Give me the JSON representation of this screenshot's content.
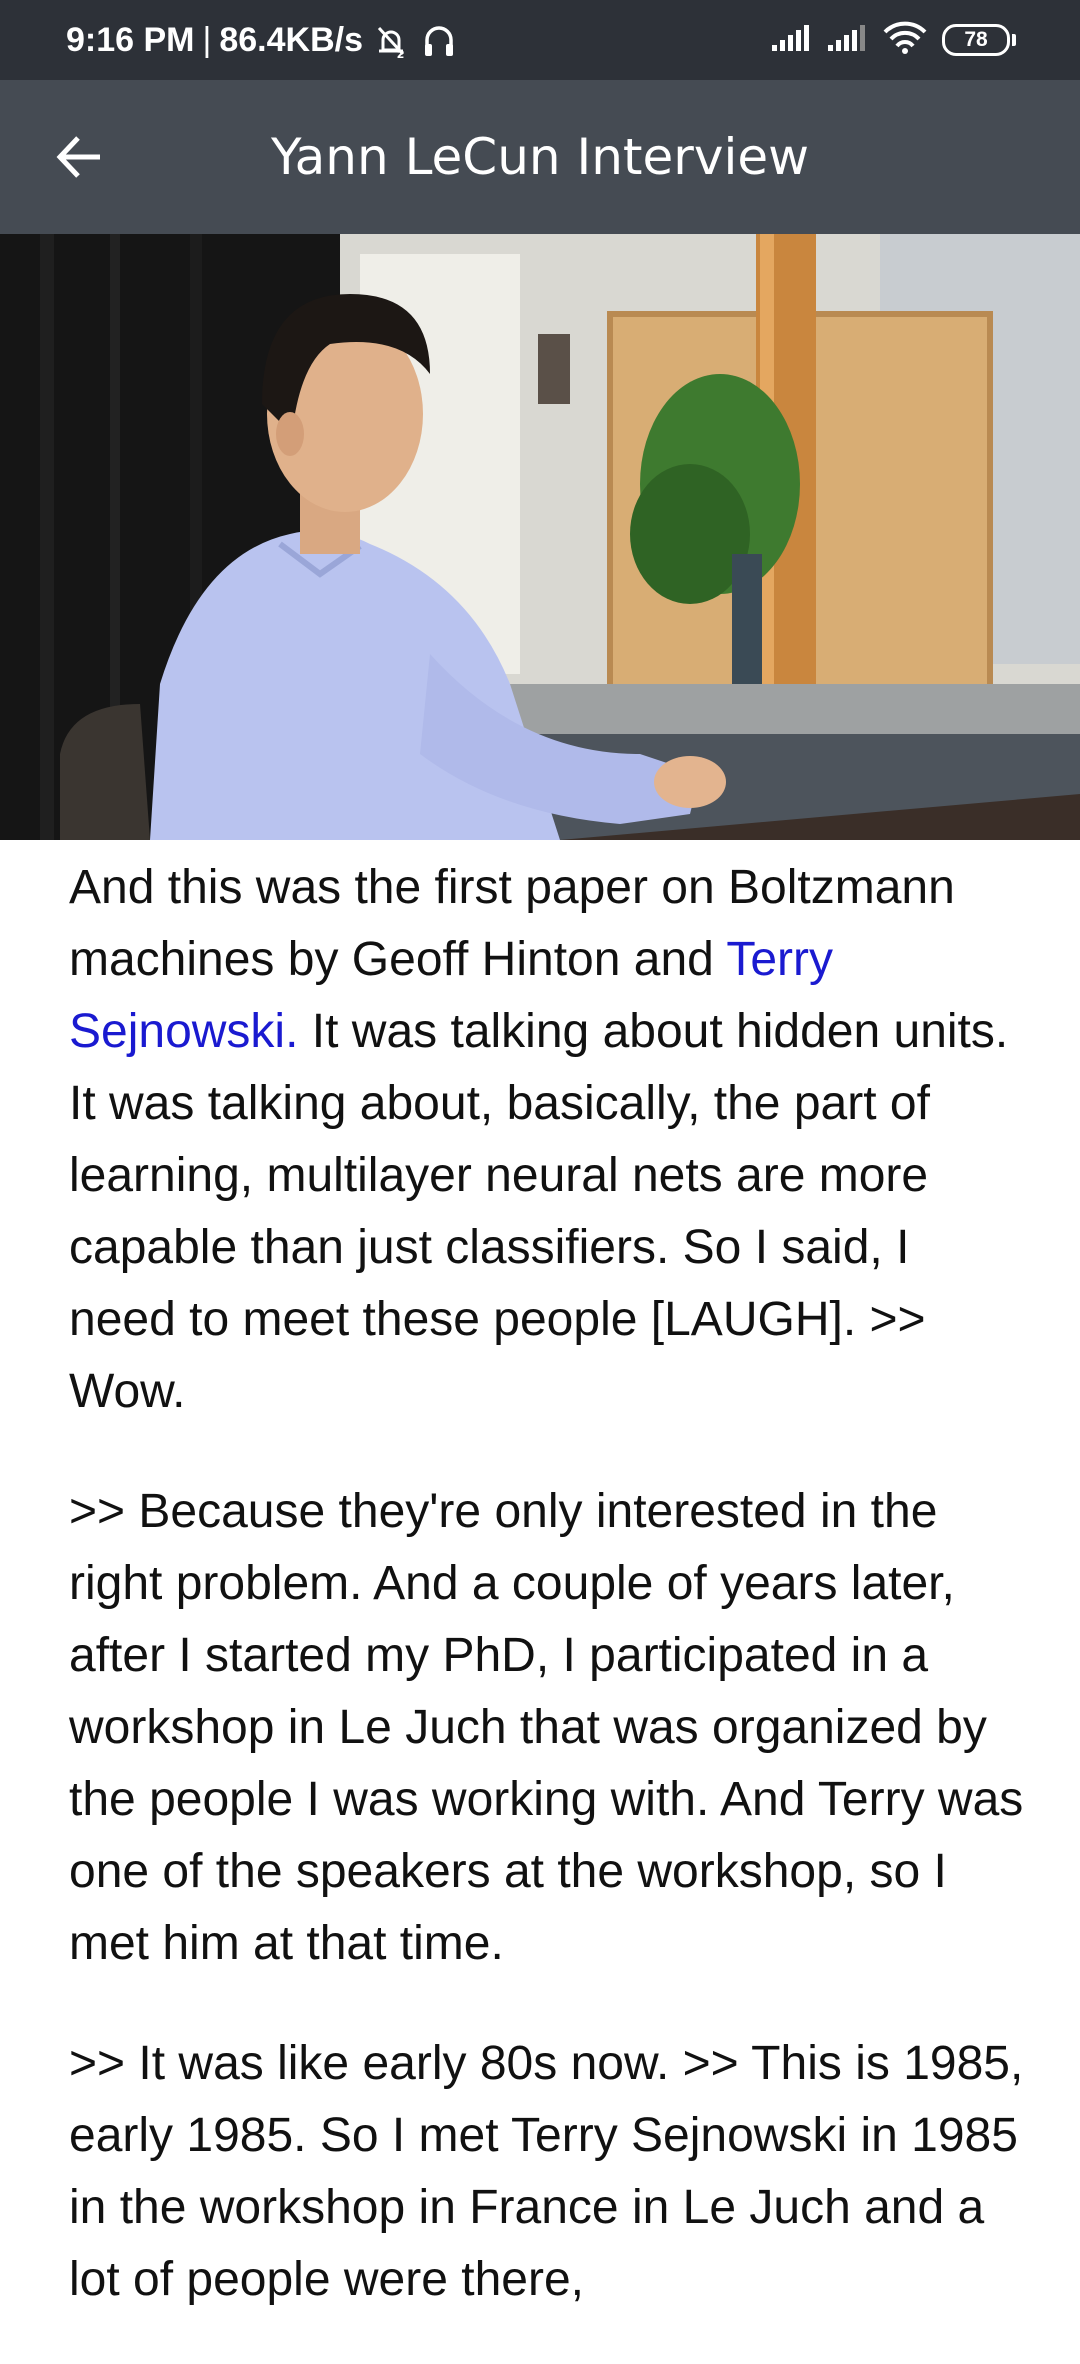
{
  "status_bar": {
    "time": "9:16 PM",
    "separator": "|",
    "speed": "86.4KB/s",
    "icons": [
      "alarm-off-icon",
      "headphones-icon",
      "signal-icon",
      "signal-icon",
      "wifi-icon"
    ],
    "battery": "78"
  },
  "app_bar": {
    "back_icon": "arrow-left-icon",
    "title": "Yann LeCun Interview"
  },
  "transcript": {
    "p1_part1": "And this was the first paper on Boltzmann machines by Geoff Hinton and ",
    "p1_link": "Terry Sejnowski.",
    "p1_part2": " It was talking about hidden units. It was talking about, basically, the part of learning, multilayer neural nets are more capable than just classifiers. So I said, I need to meet these people [LAUGH].  >> Wow.",
    "p2": ">> Because they're only interested in the right problem. And a couple of years later, after I started my PhD, I participated in a workshop in Le Juch that was organized by the people I was working with. And Terry was one of the speakers at the workshop, so I met him at that time.",
    "p3": ">> It was like early 80s now. >> This is 1985, early 1985. So I met Terry Sejnowski in 1985 in the workshop in France in Le Juch and a lot of people were there,"
  },
  "colors": {
    "status_bar": "#2d3138",
    "app_bar": "#454b53",
    "link": "#1a1ad0"
  }
}
